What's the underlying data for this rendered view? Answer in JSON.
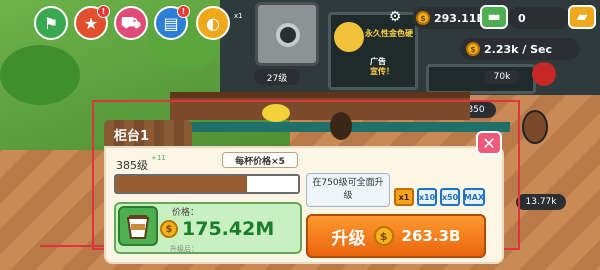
{
  "hud": {
    "icons": [
      {
        "name": "map-icon",
        "glyph": "⚑",
        "color": "#3aa851"
      },
      {
        "name": "shop-star-icon",
        "glyph": "★",
        "color": "#e0502d",
        "badge": "!"
      },
      {
        "name": "cart-icon",
        "glyph": "⛟",
        "color": "#e04a78"
      },
      {
        "name": "gift-card-icon",
        "glyph": "▤",
        "color": "#2d7fd6",
        "badge": "!"
      },
      {
        "name": "coffee-bean-icon",
        "glyph": "◐",
        "color": "#f0a81b"
      }
    ],
    "multiplier": "x1",
    "coins": "293.11B",
    "gems": "0",
    "rate": "2.23k / Sec"
  },
  "scene": {
    "level_chip": "27级",
    "board_title": "永久性金色硬",
    "board_sub": "广告",
    "board_sub2": "宣传！",
    "chip_70k": "70k",
    "chip_850": "850",
    "chip_1377": "13.77k"
  },
  "panel": {
    "title": "柜台1",
    "level": "385级",
    "level_plus": "+11",
    "price_per_cup": "每杯价格×5",
    "progress": 0.72,
    "info": "在750级可全面升级",
    "multipliers": [
      "x1",
      "x10",
      "x50",
      "MAX"
    ],
    "active_multiplier": 0,
    "price_label": "价格：",
    "price_value": "175.42M",
    "footnote": "升级后：",
    "upgrade_label": "升级",
    "upgrade_cost": "263.3B"
  },
  "colors": {
    "accent": "#f6a21b",
    "price_green": "#1a7d2e",
    "close_pink": "#ef5a7a"
  }
}
